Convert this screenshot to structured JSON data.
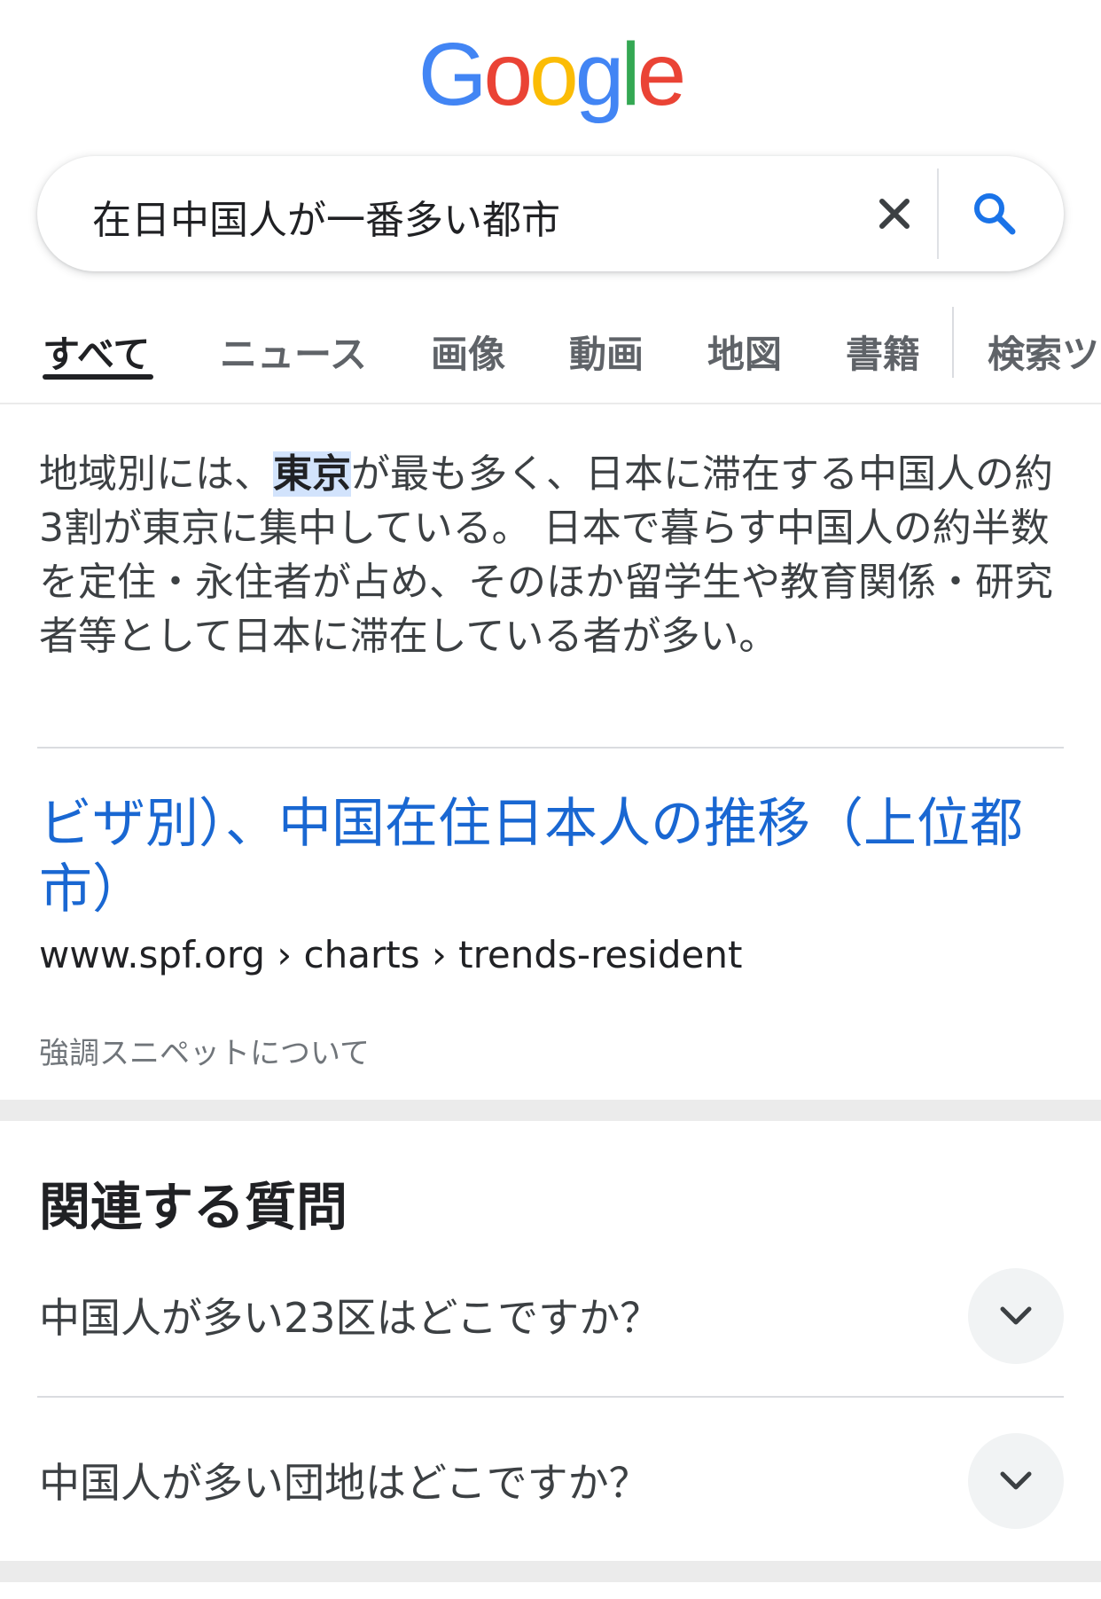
{
  "logo": {
    "letters": [
      "G",
      "o",
      "o",
      "g",
      "l",
      "e"
    ],
    "colors": [
      "#4285F4",
      "#EA4335",
      "#FBBC05",
      "#4285F4",
      "#34A853",
      "#EA4335"
    ]
  },
  "search": {
    "query": "在日中国人が一番多い都市",
    "clear_icon": "close-icon",
    "search_icon": "search-icon",
    "accent": "#1a73e8"
  },
  "tabs": [
    {
      "label": "すべて"
    },
    {
      "label": "ニュース"
    },
    {
      "label": "画像"
    },
    {
      "label": "動画"
    },
    {
      "label": "地図"
    },
    {
      "label": "書籍"
    },
    {
      "label": "検索ツ"
    }
  ],
  "snippet": {
    "before": "地域別には、",
    "highlight": "東京",
    "after": "が最も多く、日本に滞在する中国人の約3割が東京に集中している。 日本で暮らす中国人の約半数を定住・永住者が占め、そのほか留学生や教育関係・研究者等として日本に滞在している者が多い。"
  },
  "result": {
    "title": "ビザ別）、中国在住日本人の推移（上位都市）",
    "url": "www.spf.org › charts › trends-resident"
  },
  "about_snippet": "強調スニペットについて",
  "related": {
    "title": "関連する質問",
    "questions": [
      {
        "text": "中国人が多い23区はどこですか？"
      },
      {
        "text": "中国人が多い団地はどこですか？"
      }
    ]
  }
}
